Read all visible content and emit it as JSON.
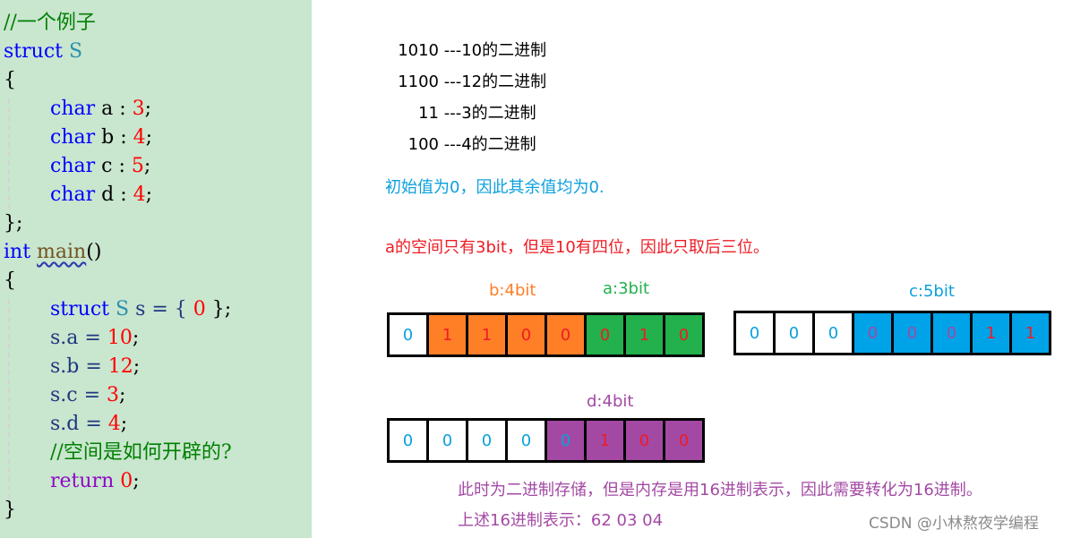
{
  "code": {
    "lines": [
      [
        "//一个例子"
      ],
      [
        "struct",
        "S"
      ],
      [
        "{"
      ],
      [
        "char",
        "a :",
        "3",
        ";"
      ],
      [
        "char",
        "b :",
        "4",
        ";"
      ],
      [
        "char",
        "c :",
        "5",
        ";"
      ],
      [
        "char",
        "d :",
        "4",
        ";"
      ],
      [
        "};"
      ],
      [
        "int",
        "main",
        "()"
      ],
      [
        "{"
      ],
      [
        "struct",
        "S",
        "s = {",
        "0",
        "};"
      ],
      [
        "s.a =",
        "10",
        ";"
      ],
      [
        "s.b =",
        "12",
        ";"
      ],
      [
        "s.c =",
        "3",
        ";"
      ],
      [
        "s.d =",
        "4",
        ";"
      ],
      [
        "//空间是如何开辟的?"
      ],
      [
        "return",
        "0",
        ";"
      ],
      [
        "}"
      ]
    ]
  },
  "binary_table": [
    {
      "bin": "1010",
      "desc": "---10的二进制"
    },
    {
      "bin": "1100",
      "desc": "---12的二进制"
    },
    {
      "bin": "11",
      "desc": "---3的二进制"
    },
    {
      "bin": "100",
      "desc": "---4的二进制"
    }
  ],
  "notes": {
    "init_note": "初始值为0，因此其余值均为0.",
    "a_note": "a的空间只有3bit，但是10有四位，因此只取后三位。",
    "storage_note": "此时为二进制存储，但是内存是用16进制表示，因此需要转化为16进制。",
    "hex_note": "上述16进制表示：62   03    04",
    "watermark": "CSDN @小林熬夜学编程"
  },
  "bytes": [
    {
      "labels": [
        {
          "text": "b:4bit",
          "color": "orange"
        },
        {
          "text": "a:3bit",
          "color": "green"
        }
      ],
      "bits": [
        {
          "v": "0",
          "fill": "white",
          "digit": "blue"
        },
        {
          "v": "1",
          "fill": "orange",
          "digit": "red"
        },
        {
          "v": "1",
          "fill": "orange",
          "digit": "red"
        },
        {
          "v": "0",
          "fill": "orange",
          "digit": "red"
        },
        {
          "v": "0",
          "fill": "orange",
          "digit": "red"
        },
        {
          "v": "0",
          "fill": "green",
          "digit": "red"
        },
        {
          "v": "1",
          "fill": "green",
          "digit": "red"
        },
        {
          "v": "0",
          "fill": "green",
          "digit": "red"
        }
      ]
    },
    {
      "labels": [
        {
          "text": "c:5bit",
          "color": "blue"
        }
      ],
      "bits": [
        {
          "v": "0",
          "fill": "white",
          "digit": "blue"
        },
        {
          "v": "0",
          "fill": "white",
          "digit": "blue"
        },
        {
          "v": "0",
          "fill": "white",
          "digit": "blue"
        },
        {
          "v": "0",
          "fill": "cyan",
          "digit": "purple"
        },
        {
          "v": "0",
          "fill": "cyan",
          "digit": "purple"
        },
        {
          "v": "0",
          "fill": "cyan",
          "digit": "purple"
        },
        {
          "v": "1",
          "fill": "cyan",
          "digit": "red"
        },
        {
          "v": "1",
          "fill": "cyan",
          "digit": "red"
        }
      ]
    },
    {
      "labels": [
        {
          "text": "d:4bit",
          "color": "purple"
        }
      ],
      "bits": [
        {
          "v": "0",
          "fill": "white",
          "digit": "blue"
        },
        {
          "v": "0",
          "fill": "white",
          "digit": "blue"
        },
        {
          "v": "0",
          "fill": "white",
          "digit": "blue"
        },
        {
          "v": "0",
          "fill": "white",
          "digit": "blue"
        },
        {
          "v": "0",
          "fill": "purple",
          "digit": "blue"
        },
        {
          "v": "1",
          "fill": "purple",
          "digit": "red"
        },
        {
          "v": "0",
          "fill": "purple",
          "digit": "red"
        },
        {
          "v": "0",
          "fill": "purple",
          "digit": "red"
        }
      ]
    }
  ]
}
